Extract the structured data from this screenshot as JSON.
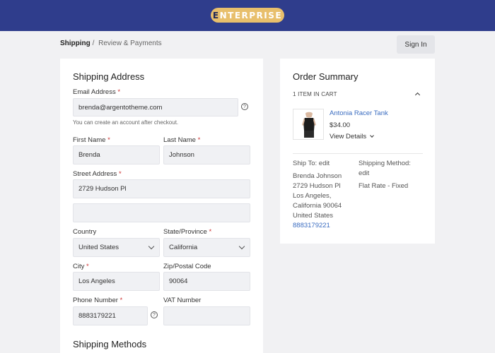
{
  "header": {
    "logo_text": "ENTERPRISE",
    "logo_first": "E",
    "logo_rest": "NTERPRISE"
  },
  "breadcrumb": {
    "current": "Shipping",
    "separator": "/",
    "next": "Review & Payments"
  },
  "signin_label": "Sign In",
  "shipping": {
    "title": "Shipping Address",
    "email_label": "Email Address",
    "email_value": "brenda@argentotheme.com",
    "email_hint": "You can create an account after checkout.",
    "first_name_label": "First Name",
    "first_name_value": "Brenda",
    "last_name_label": "Last Name",
    "last_name_value": "Johnson",
    "street_label": "Street Address",
    "street_value": "2729 Hudson Pl",
    "street2_value": "",
    "country_label": "Country",
    "country_value": "United States",
    "state_label": "State/Province",
    "state_value": "California",
    "city_label": "City",
    "city_value": "Los Angeles",
    "zip_label": "Zip/Postal Code",
    "zip_value": "90064",
    "phone_label": "Phone Number",
    "phone_value": "8883179221",
    "vat_label": "VAT Number",
    "vat_value": "",
    "methods_title": "Shipping Methods",
    "required_mark": "*",
    "help_glyph": "?"
  },
  "summary": {
    "title": "Order Summary",
    "items_in_cart": "1 ITEM IN CART",
    "product_name": "Antonia Racer Tank",
    "product_price": "$34.00",
    "view_details": "View Details",
    "ship_to_label": "Ship To: edit",
    "ship_to_lines": [
      "Brenda Johnson",
      "2729 Hudson Pl",
      "Los Angeles,",
      "California 90064",
      "United States"
    ],
    "ship_to_phone": "8883179221",
    "method_label_line1": "Shipping Method:",
    "method_label_line2": "edit",
    "method_value": "Flat Rate - Fixed"
  },
  "colors": {
    "topbar": "#2f3d8c",
    "logo_bg": "#e8bf6c",
    "link": "#3a6cc0",
    "required": "#cc3333"
  }
}
